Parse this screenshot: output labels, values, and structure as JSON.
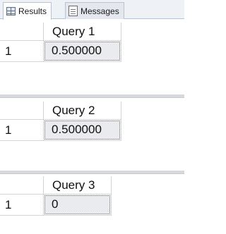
{
  "tabs": [
    {
      "label": "Results",
      "icon": "grid-icon",
      "active": true
    },
    {
      "label": "Messages",
      "icon": "messages-icon",
      "active": false
    }
  ],
  "result_sets": [
    {
      "column": "Query 1",
      "row_number": "1",
      "value": "0.500000"
    },
    {
      "column": "Query 2",
      "row_number": "1",
      "value": "0.500000"
    },
    {
      "column": "Query 3",
      "row_number": "1",
      "value": "0"
    }
  ],
  "colors": {
    "tab_bar": "#eef1f5",
    "selected_cell": "#e9ebee",
    "gridline": "#d4d4d4",
    "splitter": "#d6d9de"
  }
}
